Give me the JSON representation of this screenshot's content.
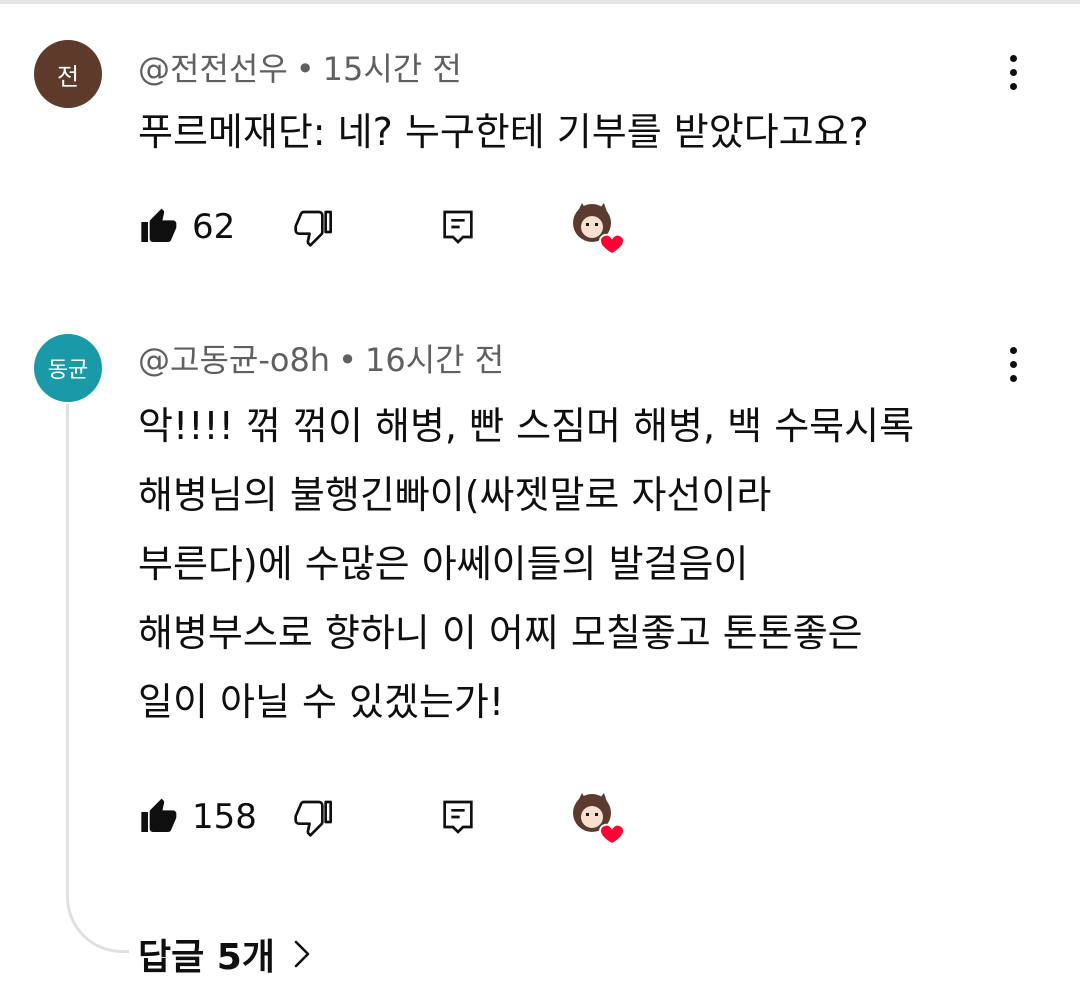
{
  "comments": [
    {
      "avatar_text": "전",
      "avatar_color": "#5d3a2a",
      "author": "@전전선우",
      "time": "15시간 전",
      "lines": [
        "푸르메재단: 네? 누구한테 기부를 받았다고요?"
      ],
      "likes": "62"
    },
    {
      "avatar_text": "동균",
      "avatar_color": "#1a9aa8",
      "author": "@고동균-o8h",
      "time": "16시간 전",
      "lines": [
        "악!!!! 꺾 꺾이 해병, 빤 스짐머 해병, 백 수묵시록",
        "해병님의 불행긴빠이(싸젯말로 자선이라",
        "부른다)에 수많은 아쎄이들의 발걸음이",
        "해병부스로 향하니 이 어찌 모칠좋고 톤톤좋은",
        "일이 아닐 수 있겠는가!"
      ],
      "likes": "158"
    }
  ],
  "separator": "•",
  "replies_label": "답글 5개",
  "heart_color": "#ff0033",
  "icons": [
    "thumb-up-icon",
    "thumb-down-icon",
    "reply-icon",
    "creator-heart-icon",
    "more-vert-icon",
    "chevron-right-icon"
  ]
}
